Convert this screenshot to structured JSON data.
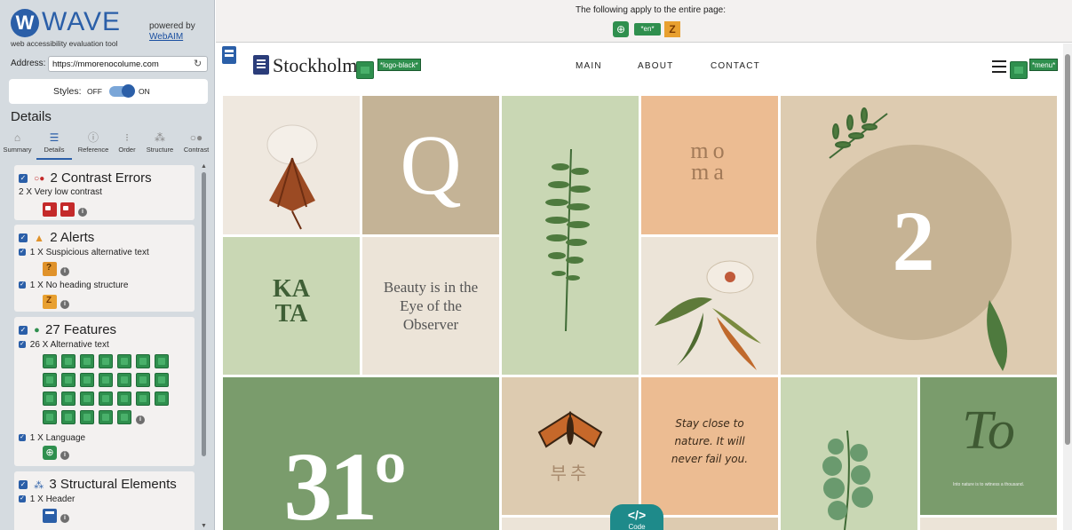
{
  "wave": {
    "brand_name": "WAVE",
    "brand_sub": "web accessibility evaluation tool",
    "powered_by": "powered by",
    "webaim": "WebAIM",
    "address_label": "Address:",
    "address_value": "https://mmorenocolume.com",
    "styles_label": "Styles:",
    "styles_off": "OFF",
    "styles_on": "ON",
    "details_heading": "Details",
    "tabs": [
      {
        "label": "Summary",
        "icon": "home-icon"
      },
      {
        "label": "Details",
        "icon": "list-icon",
        "active": true
      },
      {
        "label": "Reference",
        "icon": "info-icon"
      },
      {
        "label": "Order",
        "icon": "order-icon"
      },
      {
        "label": "Structure",
        "icon": "structure-icon"
      },
      {
        "label": "Contrast",
        "icon": "contrast-icon"
      }
    ],
    "contrast": {
      "title": "2 Contrast Errors",
      "line": "2 X Very low contrast"
    },
    "alerts": {
      "title": "2 Alerts",
      "line1": "1 X Suspicious alternative text",
      "line2": "1 X No heading structure"
    },
    "features": {
      "title": "27 Features",
      "line1": "26 X Alternative text",
      "alt_icon_count": 26,
      "line2": "1 X Language"
    },
    "structural": {
      "title": "3 Structural Elements",
      "line1": "1 X Header"
    }
  },
  "banner": {
    "text": "The following apply to the entire page:",
    "lang_tag": "*en*"
  },
  "site": {
    "brand": "Stockholm",
    "logo_alt": "*logo-black*",
    "nav": [
      "MAIN",
      "ABOUT",
      "CONTACT"
    ],
    "menu_alt": "*menu*",
    "tiles": {
      "q_letter": "Q",
      "moma": "mo\nma",
      "number_2": "2",
      "kata": "KA\nTA",
      "beauty": "Beauty is in the Eye of the Observer",
      "korean": "부추",
      "stay": "Stay close to nature. It will never fail you.",
      "to": "To",
      "to_small": "Into nature is to witness a thousand.",
      "big_number": "31º"
    },
    "code_symbol": "</>",
    "code_label": "Code"
  },
  "colors": {
    "wave_blue": "#2b5fa8",
    "feature_green": "#2f8f4e",
    "error_red": "#c42a2a",
    "alert_orange": "#e8a030",
    "tile_green": "#7a9c6c",
    "tile_sage": "#c9d7b4",
    "tile_tan": "#c4b396",
    "tile_peach": "#ecbc92",
    "tile_cream": "#ece4d8",
    "code_teal": "#1e8a8a"
  }
}
